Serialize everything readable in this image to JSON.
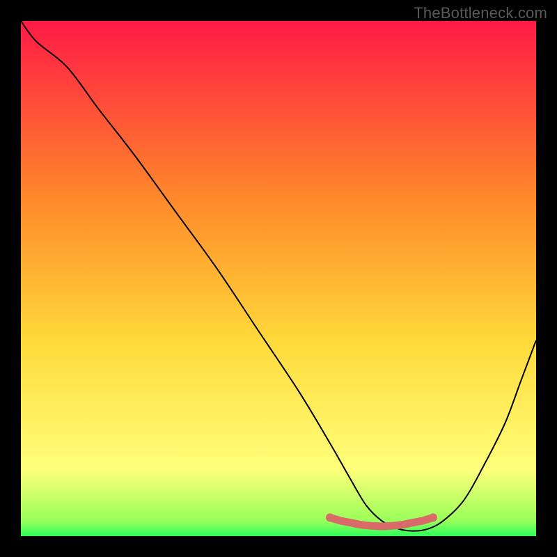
{
  "watermark": "TheBottleneck.com",
  "colors": {
    "bg": "#000000",
    "curve": "#000000",
    "segment_marker": "#d96a6a",
    "gradient_top": "#ff1a46",
    "gradient_mid1": "#ff8a2a",
    "gradient_mid2": "#ffd93a",
    "gradient_mid3": "#ffff7a",
    "gradient_bottom": "#2eff5a"
  },
  "chart_data": {
    "type": "line",
    "title": "",
    "xlabel": "",
    "ylabel": "",
    "xlim": [
      0,
      100
    ],
    "ylim": [
      0,
      100
    ],
    "x": [
      0,
      3,
      9,
      15,
      22,
      30,
      38,
      46,
      54,
      60,
      64,
      67,
      70,
      73,
      76,
      79,
      82,
      86,
      90,
      94,
      97,
      100
    ],
    "values": [
      100,
      96,
      91,
      83,
      74,
      63,
      52,
      40,
      28,
      18,
      11,
      6,
      3,
      1.5,
      1,
      1.4,
      3,
      7,
      14,
      22,
      30,
      38
    ],
    "highlight_segment": {
      "x": [
        60,
        62,
        64,
        66,
        68,
        70,
        72,
        74,
        76,
        78,
        80
      ],
      "values": [
        3.6,
        3,
        2.6,
        2.2,
        2.0,
        1.9,
        2.0,
        2.2,
        2.6,
        3.0,
        3.6
      ]
    },
    "gradient_stops": [
      {
        "offset": 0.0,
        "color": "#ff1a46"
      },
      {
        "offset": 0.35,
        "color": "#ff8a2a"
      },
      {
        "offset": 0.62,
        "color": "#ffd93a"
      },
      {
        "offset": 0.87,
        "color": "#ffff7a"
      },
      {
        "offset": 0.97,
        "color": "#9aff5a"
      },
      {
        "offset": 1.0,
        "color": "#2eff5a"
      }
    ]
  }
}
